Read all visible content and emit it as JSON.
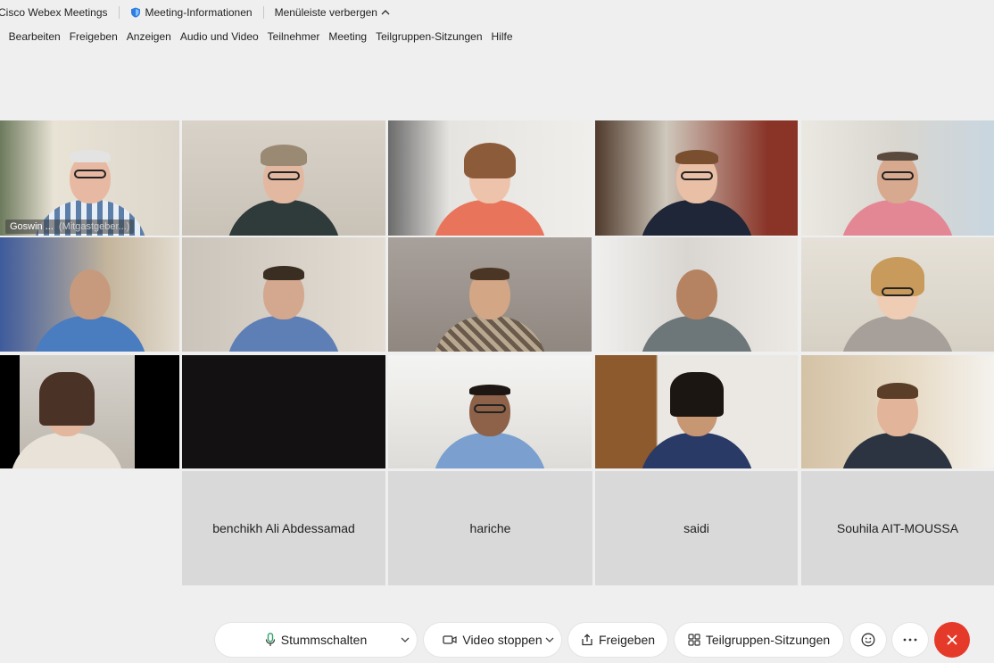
{
  "titlebar": {
    "app_name": "Cisco Webex Meetings",
    "meeting_info": "Meeting-Informationen",
    "hide_menubar": "Menüleiste verbergen"
  },
  "menu": {
    "items": [
      "i",
      "Bearbeiten",
      "Freigeben",
      "Anzeigen",
      "Audio und Video",
      "Teilnehmer",
      "Meeting",
      "Teilgruppen-Sitzungen",
      "Hilfe"
    ]
  },
  "participants": {
    "active_name": "Goswin ...",
    "active_role": "(Mitgastgeber...)",
    "name_tiles": [
      "benchikh Ali Abdessamad",
      "hariche",
      "saidi",
      "Souhila AIT-MOUSSA"
    ]
  },
  "controls": {
    "mute": "Stummschalten",
    "video": "Video stoppen",
    "share": "Freigeben",
    "breakout": "Teilgruppen-Sitzungen"
  },
  "colors": {
    "active_border": "#36b3e6",
    "end_button": "#e53a2a",
    "mic_icon": "#2aa36b"
  }
}
